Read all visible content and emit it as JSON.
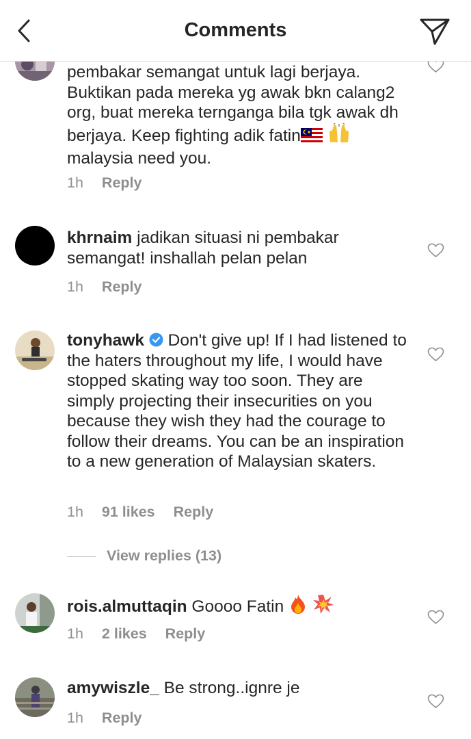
{
  "header": {
    "title": "Comments",
    "back_icon": "chevron-left-icon",
    "share_icon": "paper-plane-icon"
  },
  "comments": [
    {
      "text": "pembakar semangat untuk lagi berjaya. Buktikan pada mereka yg awak bkn calang2 org, buat mereka ternganga bila tgk awak dh berjaya. Keep fighting adik fatin",
      "text_after": "malaysia need you.",
      "time": "1h",
      "reply": "Reply"
    },
    {
      "username": "khrnaim",
      "text": "jadikan situasi ni pembakar semangat! inshallah pelan pelan",
      "time": "1h",
      "reply": "Reply"
    },
    {
      "username": "tonyhawk",
      "text": "Don't give up! If I had listened to the haters throughout my life, I would have stopped skating way too soon. They are simply projecting their insecurities on you because they wish they had the courage to follow their dreams. You can be an inspiration to a new generation of Malaysian skaters.",
      "time": "1h",
      "likes": "91 likes",
      "reply": "Reply",
      "view_replies": "View replies (13)"
    },
    {
      "username": "rois.almuttaqin",
      "text": "Goooo Fatin",
      "time": "1h",
      "likes": "2 likes",
      "reply": "Reply"
    },
    {
      "username": "amywiszle_",
      "text": "Be strong..ignre je",
      "time": "1h",
      "reply": "Reply"
    }
  ],
  "colors": {
    "text": "#262626",
    "meta": "#8e8e8e",
    "verified": "#3897f0",
    "divider": "#dbdbdb"
  }
}
